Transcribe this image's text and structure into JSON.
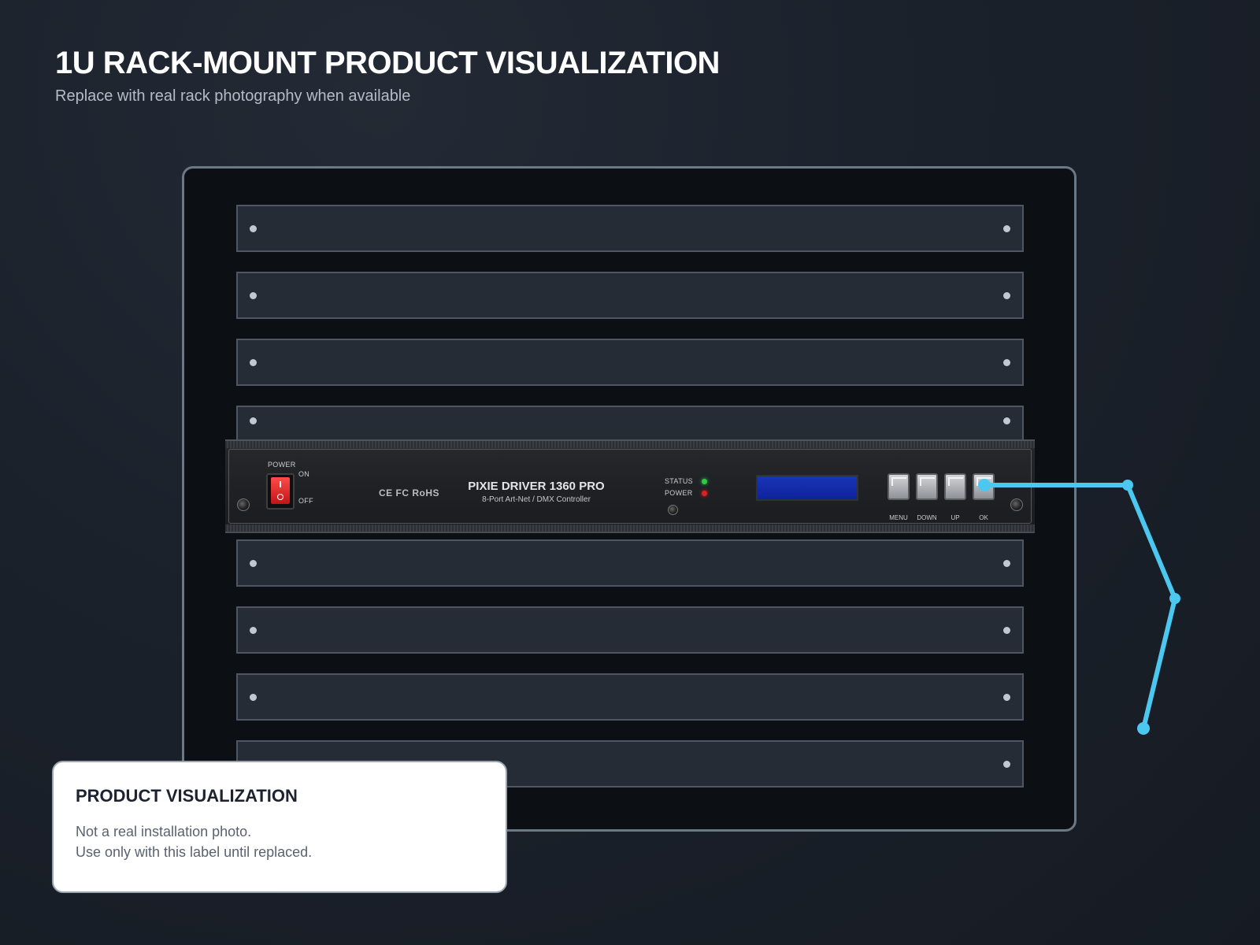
{
  "header": {
    "title": "1U RACK-MOUNT PRODUCT VISUALIZATION",
    "subtitle": "Replace with real rack photography when available"
  },
  "device": {
    "power_label": "POWER",
    "switch_on": "ON",
    "switch_off": "OFF",
    "certifications": "CE FC RoHS",
    "model_name": "PIXIE DRIVER 1360 PRO",
    "model_subtitle": "8-Port Art-Net / DMX Controller",
    "led_status_label": "STATUS",
    "led_power_label": "POWER",
    "buttons": [
      "MENU",
      "DOWN",
      "UP",
      "OK"
    ],
    "colors": {
      "status_led": "#2ecc40",
      "power_led": "#e02020",
      "lcd": "#1a34b8",
      "switch": "#e02020"
    }
  },
  "callout": {
    "color": "#4cc8f0"
  },
  "note": {
    "title": "PRODUCT VISUALIZATION",
    "line1": "Not a real installation photo.",
    "line2": "Use only with this label until replaced."
  }
}
